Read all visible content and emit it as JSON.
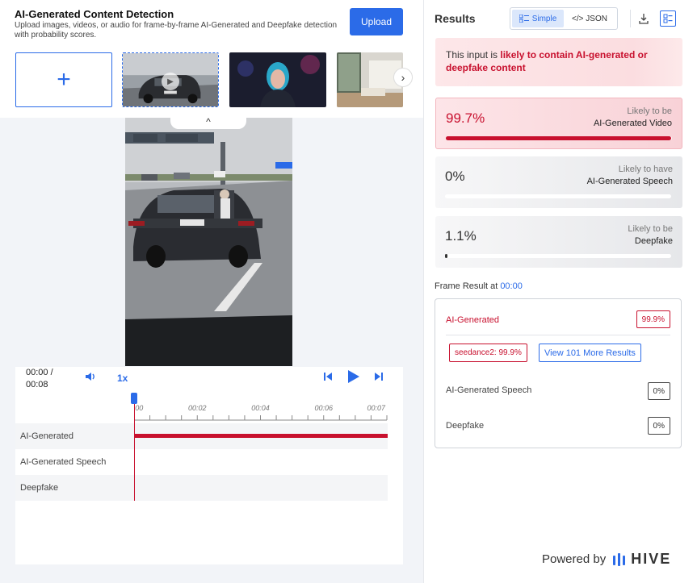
{
  "header": {
    "title": "AI-Generated Content Detection",
    "subtitle": "Upload images, videos, or audio for frame-by-frame AI-Generated and Deepfake detection with probability scores.",
    "upload_label": "Upload",
    "add_symbol": "+",
    "next_symbol": "›",
    "collapse_symbol": "^"
  },
  "player": {
    "time_current": "00:00 /",
    "time_total": "00:08",
    "speed": "1x",
    "ticks": [
      {
        "label": "00:00",
        "t": 0
      },
      {
        "label": "00:02",
        "t": 2
      },
      {
        "label": "00:04",
        "t": 4
      },
      {
        "label": "00:06",
        "t": 6
      },
      {
        "label": "00:07",
        "t": 8
      }
    ],
    "tracks": [
      {
        "label": "AI-Generated"
      },
      {
        "label": "AI-Generated Speech"
      },
      {
        "label": "Deepfake"
      }
    ]
  },
  "results": {
    "title": "Results",
    "toggle_simple": "Simple",
    "toggle_json": "</> JSON",
    "alert_prefix": "This input is ",
    "alert_highlight": "likely to contain AI-generated or deepfake content",
    "cards": [
      {
        "pct": "99.7%",
        "value": 0.997,
        "label1": "Likely to be",
        "label2": "AI-Generated Video"
      },
      {
        "pct": "0%",
        "value": 0.0,
        "label1": "Likely to have",
        "label2": "AI-Generated Speech"
      },
      {
        "pct": "1.1%",
        "value": 0.011,
        "label1": "Likely to be",
        "label2": "Deepfake"
      }
    ],
    "frame_title": "Frame Result at ",
    "frame_time": "00:00",
    "frame": {
      "ai_label": "AI-Generated",
      "ai_score": "99.9%",
      "model_tag": "seedance2: 99.9%",
      "more_label": "View 101 More Results",
      "speech_label": "AI-Generated Speech",
      "speech_score": "0%",
      "deepfake_label": "Deepfake",
      "deepfake_score": "0%"
    },
    "powered_by": "Powered by",
    "brand": "HIVE"
  },
  "colors": {
    "accent": "#2b6be8",
    "danger": "#c8102e"
  }
}
